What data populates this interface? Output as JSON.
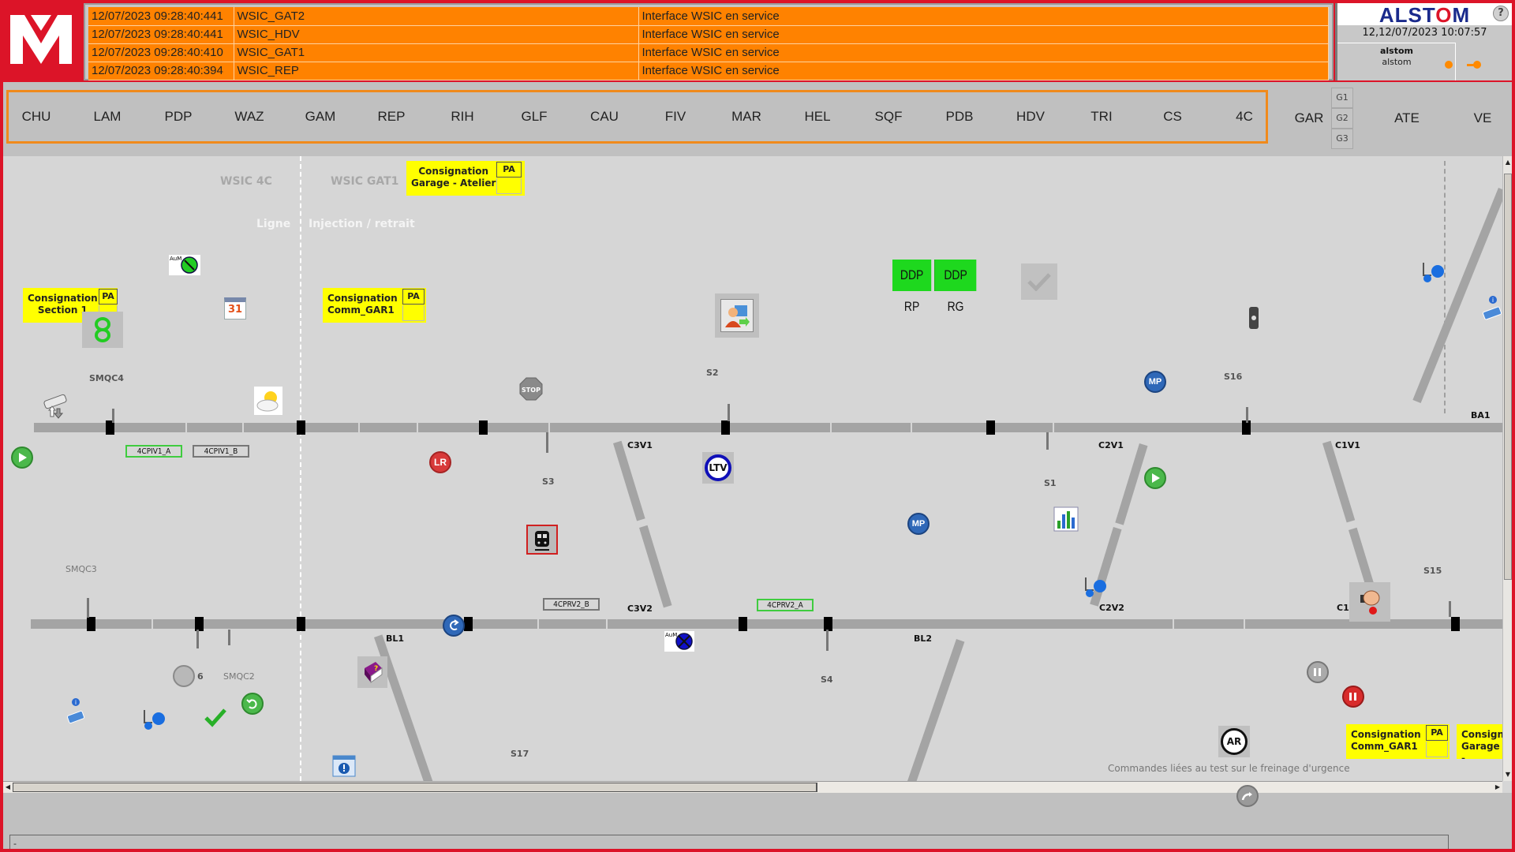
{
  "header": {
    "logo_letter": "M",
    "brand": "ALSTOM",
    "brand_pre": "ALST",
    "brand_o": "O",
    "brand_post": "M",
    "help_label": "?",
    "clock": "12,12/07/2023 10:07:57",
    "user_name": "alstom",
    "user_role": "alstom"
  },
  "alarms": [
    {
      "timestamp": "12/07/2023 09:28:40:441",
      "source": "WSIC_GAT2",
      "message": "Interface WSIC en service"
    },
    {
      "timestamp": "12/07/2023 09:28:40:441",
      "source": "WSIC_HDV",
      "message": "Interface WSIC en service"
    },
    {
      "timestamp": "12/07/2023 09:28:40:410",
      "source": "WSIC_GAT1",
      "message": "Interface WSIC en service"
    },
    {
      "timestamp": "12/07/2023 09:28:40:394",
      "source": "WSIC_REP",
      "message": "Interface WSIC en service"
    }
  ],
  "stations": [
    "CHU",
    "LAM",
    "PDP",
    "WAZ",
    "GAM",
    "REP",
    "RIH",
    "GLF",
    "CAU",
    "FIV",
    "MAR",
    "HEL",
    "SQF",
    "PDB",
    "HDV",
    "TRI",
    "CS",
    "4C"
  ],
  "stations_extra": [
    "GAR",
    "ATE",
    "VE"
  ],
  "garage_buttons": [
    "G1",
    "G2",
    "G3"
  ],
  "map": {
    "zone_left": "WSIC 4C",
    "zone_right": "WSIC GAT1",
    "sub_left": "Ligne",
    "sub_right": "Injection / retrait",
    "consignations": [
      {
        "line1": "Consignation",
        "line2": "Garage - Atelier",
        "pa": "PA"
      },
      {
        "line1": "Consignation",
        "line2": "Section 1",
        "pa": "PA"
      },
      {
        "line1": "Consignation",
        "line2": "Comm_GAR1",
        "pa": "PA"
      },
      {
        "line1": "Consignation",
        "line2": "Comm_GAR1",
        "pa": "PA"
      },
      {
        "line1": "Consign",
        "line2": "Garage -"
      }
    ],
    "ddp": [
      "DDP RP",
      "DDP RG"
    ],
    "signals": {
      "smqc4": "SMQC4",
      "smqc3": "SMQC3",
      "smqc2": "SMQC2",
      "s1": "S1",
      "s2": "S2",
      "s3": "S3",
      "s4": "S4",
      "s15": "S15",
      "s16": "S16",
      "s17": "S17",
      "six": "6"
    },
    "track_labels": {
      "c3v1": "C3V1",
      "c3v2": "C3V2",
      "c2v1": "C2V1",
      "c2v2": "C2V2",
      "c1v1": "C1V1",
      "c1v2": "C1'",
      "bl1": "BL1",
      "bl2": "BL2",
      "ba1": "BA1"
    },
    "cv_boxes": [
      {
        "label": "4CPIV1_A",
        "state": "green"
      },
      {
        "label": "4CPIV1_B",
        "state": "gray"
      },
      {
        "label": "4CPRV2_B",
        "state": "gray"
      },
      {
        "label": "4CPRV2_A",
        "state": "green"
      }
    ],
    "icon_labels": {
      "aum": "AuM",
      "lr": "LR",
      "ltv": "LTV",
      "mp": "MP",
      "ar": "AR",
      "stop": "STOP",
      "calendar": "31"
    },
    "hint": "Commandes liées au test sur le freinage d'urgence"
  },
  "status_bar": {
    "text": "-"
  },
  "colors": {
    "brand_red": "#dc1428",
    "alarm_orange": "#ff8200",
    "station_border": "#f08a1c",
    "consign_yellow": "#ffff00",
    "ddp_green": "#1ed81e",
    "track_gray": "#a4a4a4"
  }
}
